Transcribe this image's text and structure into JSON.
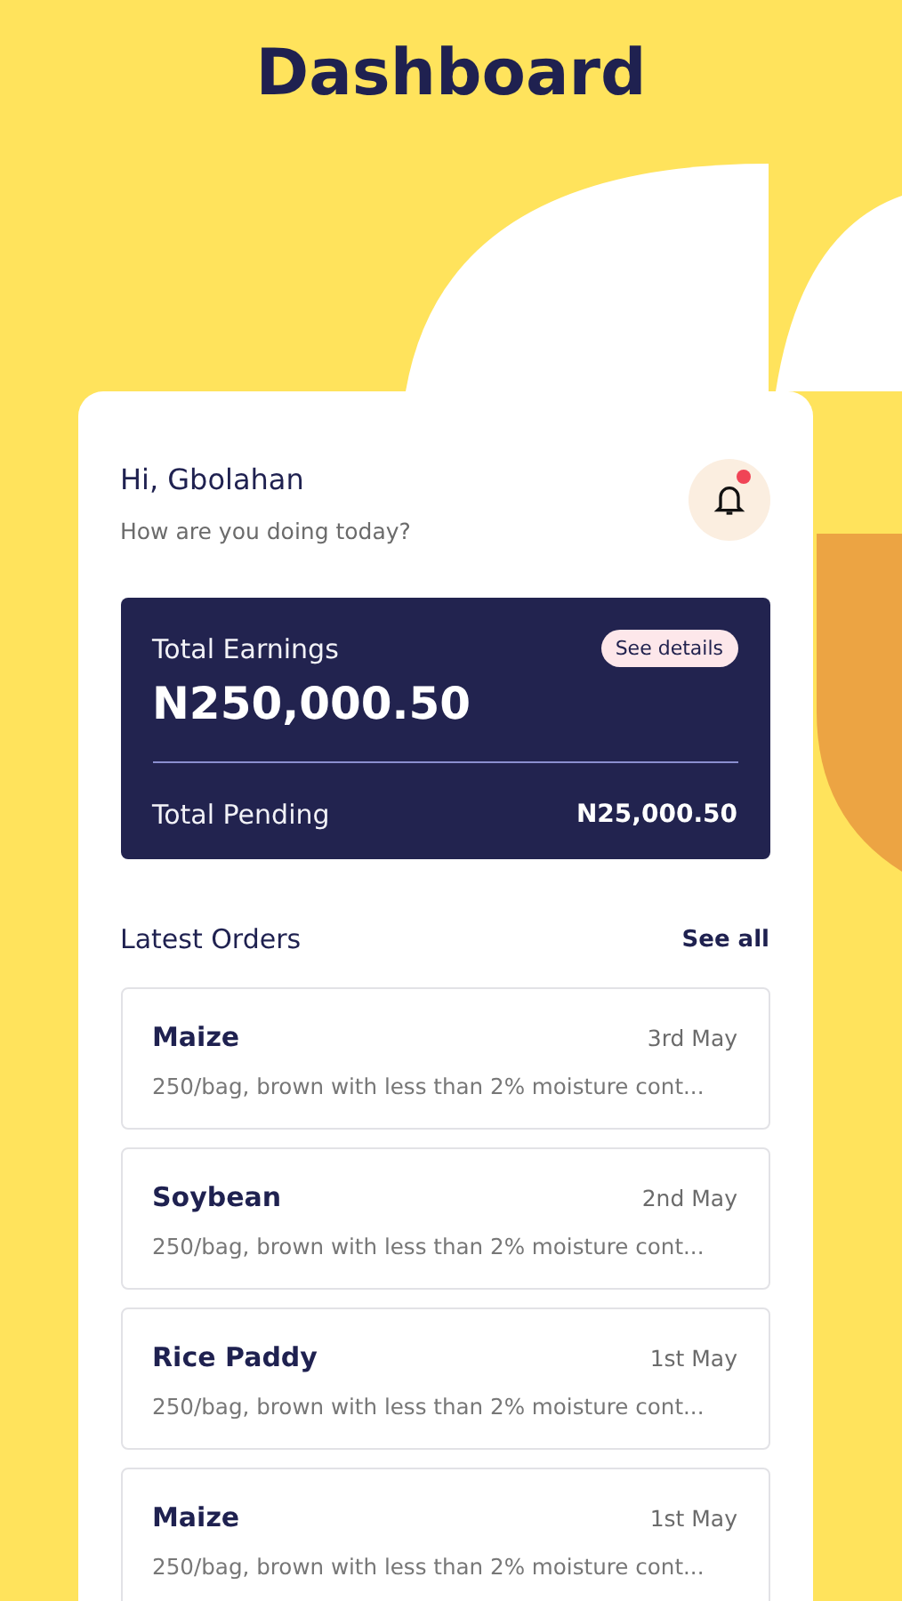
{
  "title": "Dashboard",
  "greeting": {
    "title": "Hi, Gbolahan",
    "subtitle": "How are you doing today?",
    "has_notification": true
  },
  "earnings": {
    "label": "Total Earnings",
    "amount": "N250,000.50",
    "details_button": "See details",
    "pending_label": "Total Pending",
    "pending_amount": "N25,000.50"
  },
  "orders_section": {
    "title": "Latest Orders",
    "see_all": "See all"
  },
  "orders": [
    {
      "name": "Maize",
      "date": "3rd May",
      "description": "250/bag, brown with less than 2% moisture cont..."
    },
    {
      "name": "Soybean",
      "date": "2nd May",
      "description": "250/bag, brown with less than 2% moisture cont..."
    },
    {
      "name": "Rice Paddy",
      "date": "1st May",
      "description": "250/bag, brown with less than 2% moisture cont..."
    },
    {
      "name": "Maize",
      "date": "1st May",
      "description": "250/bag, brown with less than 2% moisture cont..."
    }
  ]
}
